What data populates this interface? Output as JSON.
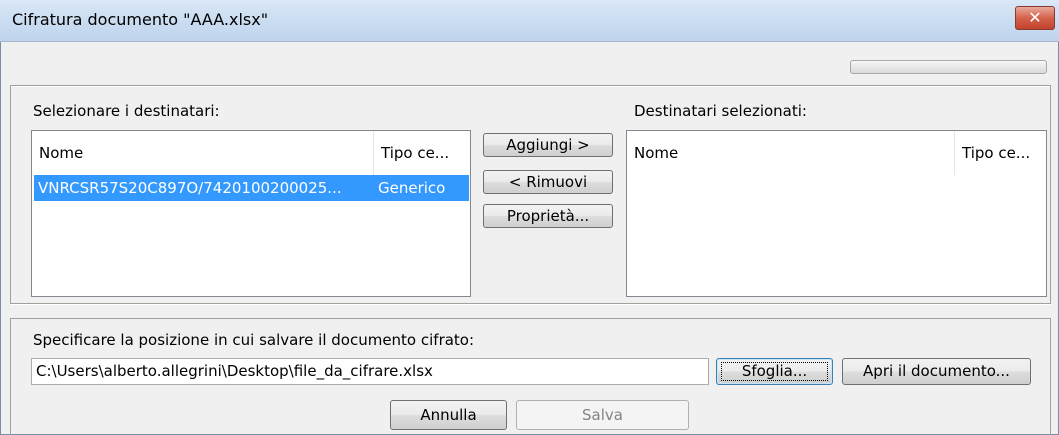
{
  "window": {
    "title": "Cifratura documento \"AAA.xlsx\"",
    "close_symbol": "✕"
  },
  "progress": {
    "value": 0.0
  },
  "recipients": {
    "label": "Selezionare i destinatari:",
    "columns": [
      "Nome",
      "Tipo ce..."
    ],
    "rows": [
      {
        "name": "VNRCSR57S20C897O/7420100200025...",
        "type": "Generico",
        "selected": true
      }
    ]
  },
  "selected_recipients": {
    "label": "Destinatari selezionati:",
    "columns": [
      "Nome",
      "Tipo ce..."
    ],
    "rows": []
  },
  "actions": {
    "add": "Aggiungi >",
    "remove": "< Rimuovi",
    "properties": "Proprietà..."
  },
  "save_location": {
    "label": "Specificare la posizione in cui salvare il documento cifrato:",
    "path": "C:\\Users\\alberto.allegrini\\Desktop\\file_da_cifrare.xlsx",
    "browse": "Sfoglia...",
    "open_document": "Apri il documento..."
  },
  "footer": {
    "cancel": "Annulla",
    "save": "Salva"
  },
  "colors": {
    "selection": "#3399ff",
    "close_button": "#c2412b",
    "title_bar": "#c9dcf1"
  }
}
